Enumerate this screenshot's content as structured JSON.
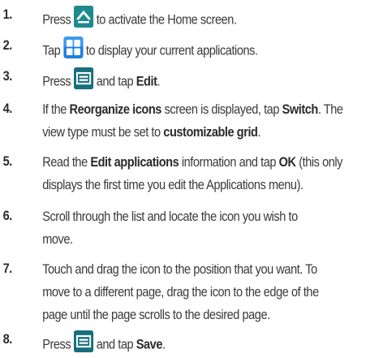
{
  "steps": [
    {
      "number": "1.",
      "before": "Press",
      "icon": "home-key-icon",
      "after": "to activate the Home screen."
    },
    {
      "number": "2.",
      "before": "Tap",
      "icon": "applications-icon",
      "after": "to display your current applications."
    },
    {
      "number": "3.",
      "before": "Press",
      "icon": "menu-key-icon",
      "middle": "and tap",
      "bold": "Edit",
      "end": "."
    },
    {
      "number": "4.",
      "line1": {
        "t1": "If the",
        "b1": "Reorganize icons",
        "t2": "screen is displayed, tap",
        "b2": "Switch",
        "t3": ". The"
      },
      "line2": {
        "t1": "view type must be set to",
        "b1": "customizable grid",
        "t2": "."
      }
    },
    {
      "number": "5.",
      "line1": {
        "t1": "Read the",
        "b1": "Edit applications",
        "t2": "information and tap",
        "b2": "OK",
        "t3": "(this only"
      },
      "line2": "displays the first time you edit the Applications menu)."
    },
    {
      "number": "6.",
      "line1": "Scroll through the list and locate the icon you wish to",
      "line2": "move."
    },
    {
      "number": "7.",
      "line1": "Touch and drag the icon to the position that you want. To",
      "line2": "move to a different page, drag the icon to the edge of the",
      "line3": "page until the page scrolls to the desired page."
    },
    {
      "number": "8.",
      "before": "Press",
      "icon": "menu-key-icon",
      "middle": "and tap",
      "bold": "Save",
      "end": "."
    }
  ],
  "colors": {
    "home_key": "#1e8a8e",
    "apps_blue": "#1f7fe0",
    "menu_key": "#176f7c"
  }
}
